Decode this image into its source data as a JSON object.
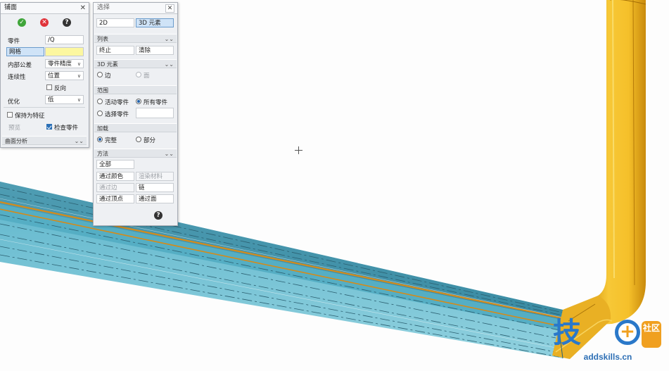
{
  "fillet_panel": {
    "title": "铺面",
    "rows": {
      "part_label": "零件",
      "part_value": "/Q",
      "mesh_label": "网格",
      "tolerance_label": "内部公差",
      "tolerance_value": "零件精度",
      "continuity_label": "连续性",
      "continuity_value": "位置",
      "reverse_label": "反向",
      "optimize_label": "优化",
      "optimize_value": "低",
      "keep_feature_label": "保持为特征",
      "preview_label": "预览",
      "check_parts_label": "检查零件",
      "curvature_section": "曲面分析"
    }
  },
  "select_panel": {
    "title": "选择",
    "mode_2d": "2D",
    "mode_3d": "3D 元素",
    "list_section": "列表",
    "stop_button": "终止",
    "clear_button": "清除",
    "elements_section": "3D 元素",
    "edge_label": "边",
    "face_label": "面",
    "scope_section": "范围",
    "active_part_label": "活动零件",
    "all_parts_label": "所有零件",
    "selected_part_label": "选择零件",
    "add_section": "加载",
    "full_label": "完整",
    "partial_label": "部分",
    "method_section": "方法",
    "method_buttons": [
      "全部",
      "通过颜色",
      "渲染材料",
      "通过边",
      "链",
      "通过顶点",
      "通过面"
    ]
  },
  "watermark": {
    "main_glyph": "技",
    "plus_glyph": "+",
    "badge_text": "社区",
    "url": "addskills.cn"
  },
  "colors": {
    "pipe_teal": "#4da9c2",
    "pipe_yellow": "#f2b722",
    "accent_blue": "#2a78c9",
    "accent_orange": "#f0a020"
  },
  "icons": [
    "check-icon",
    "cancel-icon",
    "help-icon",
    "close-icon",
    "chevron-down-icon"
  ]
}
